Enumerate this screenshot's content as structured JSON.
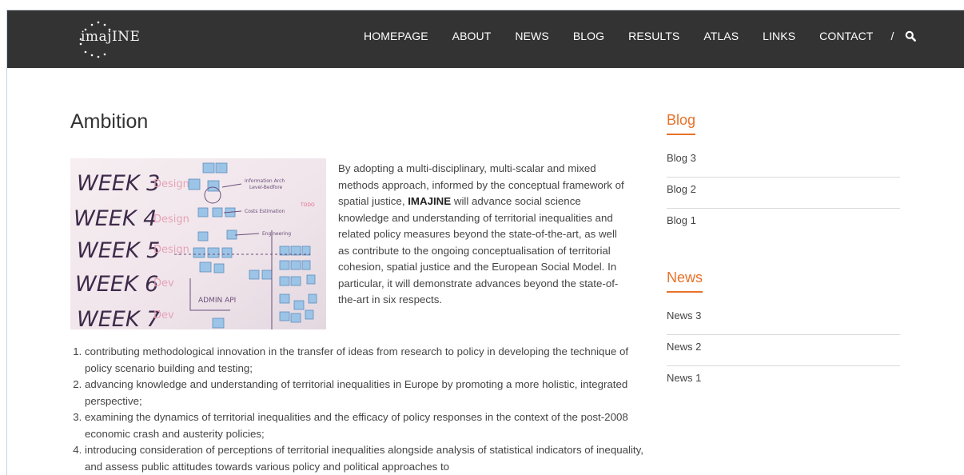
{
  "brand": {
    "logo_text": "imajINE"
  },
  "nav": {
    "items": [
      "HOMEPAGE",
      "ABOUT",
      "NEWS",
      "BLOG",
      "RESULTS",
      "ATLAS",
      "LINKS",
      "CONTACT"
    ],
    "separator": "/",
    "search_icon": "search-icon"
  },
  "page": {
    "title": "Ambition",
    "intro_before": "By adopting a multi-disciplinary, multi-scalar and mixed methods approach, informed by the conceptual framework of spatial justice, ",
    "intro_bold": "IMAJINE",
    "intro_after": " will advance social science knowledge and understanding of territorial inequalities and related policy measures beyond the state-of-the-art, as well as contribute to the ongoing conceptualisation of territorial cohesion, spatial justice and the European Social Model. In particular, it will demonstrate advances beyond the state-of-the-art in six respects.",
    "points": [
      "contributing methodological innovation in the transfer of ideas from research to policy in developing the technique of policy scenario building and testing;",
      "advancing knowledge and understanding of territorial inequalities in Europe by promoting a more holistic, integrated perspective;",
      "examining the dynamics of territorial inequalities and the efficacy of policy responses in the context of the post-2008 economic crash and austerity policies;",
      "introducing consideration of perceptions of territorial inequalities alongside analysis of statistical indicators of inequality, and assess public attitudes towards various policy and political approaches to"
    ]
  },
  "sidebar": {
    "blog": {
      "heading": "Blog",
      "items": [
        "Blog 3",
        "Blog 2",
        "Blog 1"
      ]
    },
    "news": {
      "heading": "News",
      "items": [
        "News 3",
        "News 2",
        "News 1"
      ]
    }
  },
  "hero_image": {
    "board_text": [
      "WEEK 3",
      "WEEK 4",
      "WEEK 5",
      "WEEK 6",
      "WEEK 7"
    ],
    "side_text": [
      "Design",
      "Design",
      "Design",
      "Dev",
      "Dev"
    ]
  },
  "colors": {
    "header_bg": "#333333",
    "accent": "#e8722a",
    "text": "#444444"
  }
}
